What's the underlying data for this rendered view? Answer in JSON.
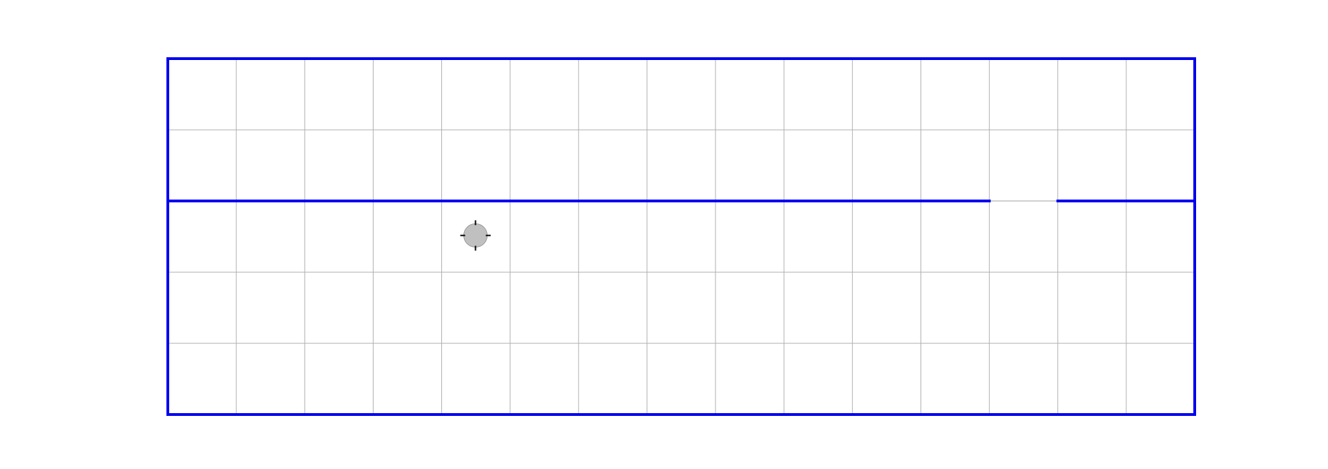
{
  "board": {
    "columns": 15,
    "rows": 5,
    "colors": {
      "background": "#ffffff",
      "grid": "#b0b0b0",
      "wall": "#0000ee",
      "agent_fill": "#c0c0c0",
      "agent_stroke": "#999999",
      "agent_ticks": "#000000"
    },
    "walls": [
      {
        "orientation": "horizontal",
        "line": 2,
        "from": 0,
        "to": 12
      },
      {
        "orientation": "horizontal",
        "line": 2,
        "from": 13,
        "to": 15
      }
    ],
    "gap": {
      "orientation": "horizontal",
      "line": 2,
      "from": 12,
      "to": 13
    },
    "agent": {
      "col": 4,
      "row": 2,
      "icon": "agent-token-icon"
    }
  }
}
